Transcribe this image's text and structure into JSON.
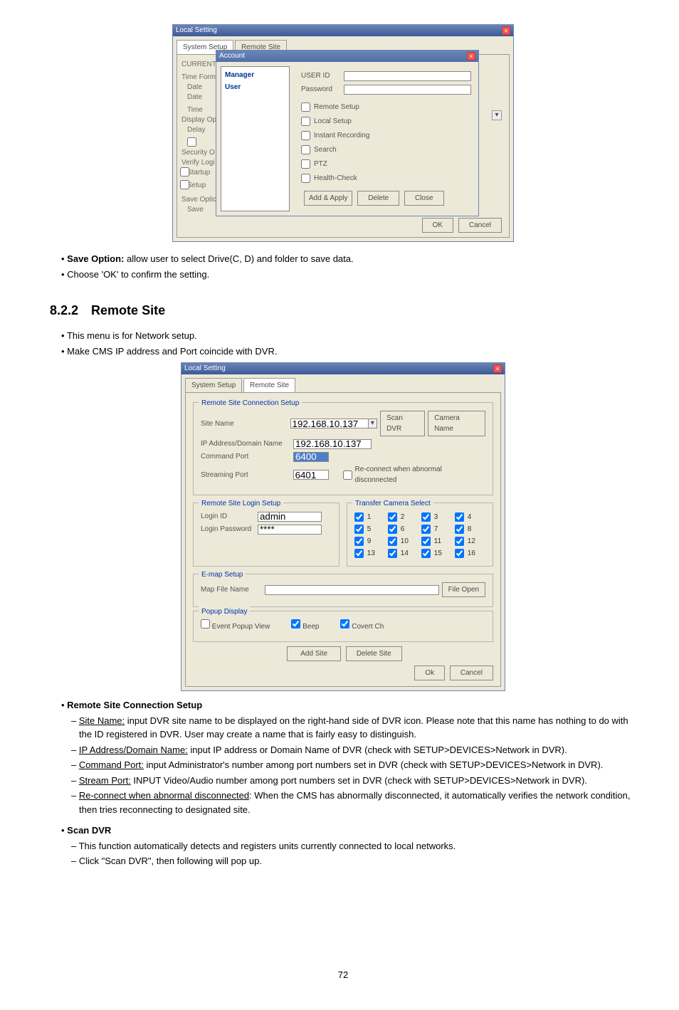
{
  "sect_num": "8.2.2",
  "sect_title": "Remote Site",
  "page_number": "72",
  "bullets_top": {
    "save_opt_label": "Save Option:",
    "save_opt_text": " allow user to select Drive(C, D) and folder to save data.",
    "choose_ok": "Choose 'OK' to confirm the setting."
  },
  "bullets_after_heading": {
    "b1": "This menu is for Network setup.",
    "b2": "Make CMS IP address and Port coincide with DVR."
  },
  "screenshot1": {
    "window_title": "Local Setting",
    "tab_system": "System Setup",
    "tab_remote": "Remote Site",
    "bg_current": "CURRENT",
    "bg_labels": {
      "time_form": "Time Form",
      "date": "Date",
      "date2": "Date",
      "time": "Time",
      "display_op": "Display Op",
      "delay": "Delay",
      "security_o": "Security O",
      "verify_login": "Verify Logi",
      "startup": "Startup",
      "setup": "Setup",
      "save_opti": "Save Optic",
      "save": "Save"
    },
    "acct_title": "Account",
    "list_manager": "Manager",
    "list_user": "User",
    "user_id": "USER ID",
    "password": "Password",
    "cb_remote_setup": "Remote Setup",
    "cb_local_setup": "Local Setup",
    "cb_instant_recording": "Instant Recording",
    "cb_search": "Search",
    "cb_ptz": "PTZ",
    "cb_health": "Health-Check",
    "btn_add_apply": "Add & Apply",
    "btn_delete": "Delete",
    "btn_close": "Close",
    "btn_ok": "OK",
    "btn_cancel": "Cancel"
  },
  "screenshot2": {
    "window_title": "Local Setting",
    "tab_system": "System Setup",
    "tab_remote": "Remote Site",
    "fs_conn": "Remote Site Connection Setup",
    "lbl_site_name": "Site Name",
    "val_site_name": "192.168.10.137",
    "btn_scan_dvr": "Scan DVR",
    "btn_camera_name": "Camera Name",
    "lbl_ip": "IP Address/Domain Name",
    "val_ip": "192.168.10.137",
    "lbl_cmd_port": "Command Port",
    "val_cmd_port": "6400",
    "lbl_stream_port": "Streaming Port",
    "val_stream_port": "6401",
    "cb_reconnect": "Re-connect when abnormal disconnected",
    "fs_login": "Remote Site Login Setup",
    "lbl_login_id": "Login ID",
    "val_login_id": "admin",
    "lbl_login_pw": "Login Password",
    "val_login_pw": "****",
    "fs_transfer": "Transfer Camera Select",
    "cams": [
      "1",
      "2",
      "3",
      "4",
      "5",
      "6",
      "7",
      "8",
      "9",
      "10",
      "11",
      "12",
      "13",
      "14",
      "15",
      "16"
    ],
    "fs_emap": "E-map Setup",
    "lbl_map_file": "Map File Name",
    "btn_file_open": "File Open",
    "fs_popup": "Popup Display",
    "cb_event_popup": "Event Popup View",
    "cb_beep": "Beep",
    "cb_covert": "Covert Ch",
    "btn_add_site": "Add Site",
    "btn_delete_site": "Delete Site",
    "btn_ok": "Ok",
    "btn_cancel": "Cancel"
  },
  "descriptions": {
    "remote_conn_head": "Remote Site Connection Setup",
    "site_name_label": "Site Name:",
    "site_name_text": " input DVR site name to be displayed on the right-hand side of DVR icon. Please note that this name has nothing to do with the ID registered in DVR. User may create a name that is fairly easy to distinguish.",
    "ip_label": "IP Address/Domain Name:",
    "ip_text": " input IP address or Domain Name of DVR (check with SETUP>DEVICES>Network in DVR).",
    "cmd_label": "Command Port:",
    "cmd_text": " input Administrator's number among port numbers set in DVR (check with SETUP>DEVICES>Network in DVR).",
    "stream_label": "Stream Port:",
    "stream_text": " INPUT Video/Audio number among port numbers set in DVR (check with SETUP>DEVICES>Network in DVR).",
    "reconn_label": "Re-connect when abnormal disconnected",
    "reconn_text": ": When the CMS has abnormally disconnected, it automatically verifies the network condition, then tries reconnecting to designated site.",
    "scan_head": "Scan DVR",
    "scan_b1": "This function automatically detects and registers units currently connected to local networks.",
    "scan_b2": "Click \"Scan DVR\", then following will pop up."
  }
}
